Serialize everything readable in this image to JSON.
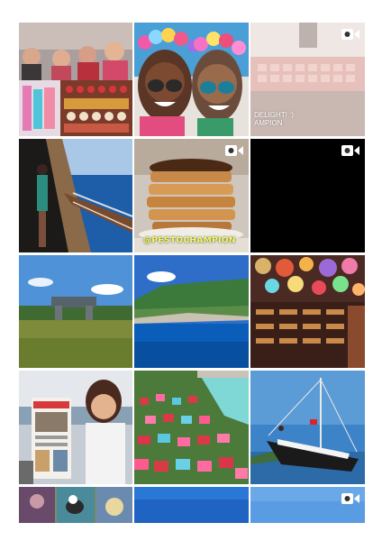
{
  "grid": {
    "tiles": [
      {
        "name": "friends-collage",
        "video": false
      },
      {
        "name": "flower-crown-selfie",
        "video": false
      },
      {
        "name": "delight-dessert",
        "video": true,
        "caption_line1": "DELIGHT! :)",
        "caption_line2": "AMPION"
      },
      {
        "name": "boat-deck-woman",
        "video": false
      },
      {
        "name": "pancake-stack",
        "video": true,
        "caption": "@PESTOCHAMPION"
      },
      {
        "name": "black-video",
        "video": true
      },
      {
        "name": "field-ruins",
        "video": false
      },
      {
        "name": "bay-coastline",
        "video": false
      },
      {
        "name": "lantern-bazaar",
        "video": false
      },
      {
        "name": "woman-with-newspaper",
        "video": false
      },
      {
        "name": "pool-beanbags",
        "video": false
      },
      {
        "name": "sailboat-flag",
        "video": false
      },
      {
        "name": "dogs-collage",
        "video": false
      },
      {
        "name": "blue-sea",
        "video": false
      },
      {
        "name": "sky-video",
        "video": true
      }
    ]
  },
  "icons": {
    "video": "video-camera-icon"
  }
}
